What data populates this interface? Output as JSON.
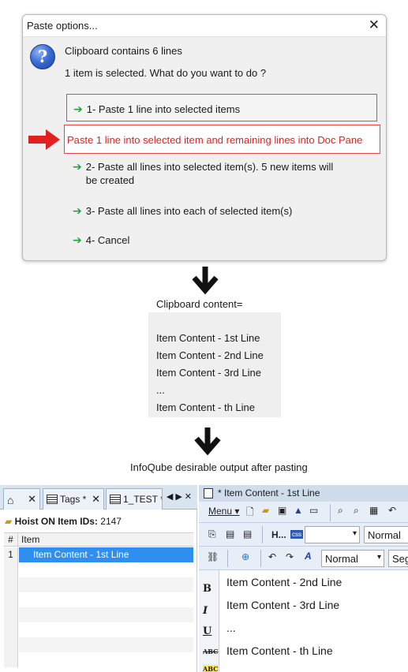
{
  "dialog": {
    "title": "Paste options...",
    "close_glyph": "✕",
    "icon": "question-icon",
    "message_line1": "Clipboard contains 6 lines",
    "message_line2": "1 item is selected. What do you want to do ?",
    "options": [
      {
        "label": "1- Paste 1 line into selected items"
      },
      {
        "label": "2- Paste all lines into selected item(s). 5 new items will be created"
      },
      {
        "label": "3- Paste all lines into each of selected item(s)"
      },
      {
        "label": "4- Cancel"
      }
    ],
    "highlight_label": "Paste 1 line into selected item and remaining lines into Doc Pane",
    "accent_red": "#e22020",
    "arrow_green": "#22a33c"
  },
  "clipboard": {
    "caption": "Clipboard content=",
    "lines": [
      "Item Content - 1st Line",
      "Item Content - 2nd Line",
      "Item Content - 3rd Line",
      "...",
      "Item Content - th Line"
    ]
  },
  "output_caption": "InfoQube desirable output after pasting",
  "infoqube": {
    "tabs": [
      {
        "icon": "home-icon",
        "label": ""
      },
      {
        "icon": "grid-icon",
        "label": "Tags *"
      },
      {
        "icon": "grid-icon",
        "label": "1_TEST *"
      }
    ],
    "hoist_label": "Hoist ON Item IDs:",
    "hoist_value": "2147",
    "grid_headers": {
      "num": "#",
      "item": "Item"
    },
    "rows": [
      {
        "num": "1",
        "item": "Item Content - 1st Line"
      }
    ],
    "selected_color": "#2f8ff0",
    "doc_title": "* Item Content - 1st Line",
    "toolbar": {
      "menu_label": "Menu",
      "style_label": "H...",
      "css_label": "css",
      "font_value": "Normal",
      "paragraph_value": "Normal",
      "segment_value": "Seg"
    },
    "format_buttons": [
      "B",
      "I",
      "U",
      "ABC",
      "ABC"
    ],
    "doc_lines": [
      "Item Content - 2nd Line",
      "Item Content - 3rd Line",
      "...",
      "Item Content - th Line"
    ]
  }
}
